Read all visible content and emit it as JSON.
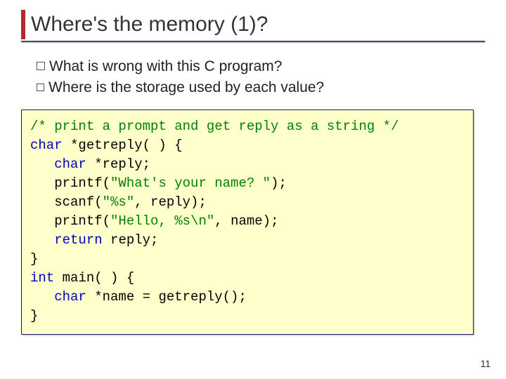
{
  "title": "Where's the memory (1)?",
  "bullets": {
    "b1": "What is wrong with this C program?",
    "b2": "Where is the storage used by each value?"
  },
  "code": {
    "c1": "/* print a prompt and get reply as a string */",
    "l2a": "char",
    "l2b": " *getreply( ) {",
    "l3a": "char",
    "l3b": " *reply;",
    "l4a": "   printf(",
    "l4s": "\"What's your name? \"",
    "l4b": ");",
    "l5a": "   scanf(",
    "l5s": "\"%s\"",
    "l5b": ", reply);",
    "l6a": "   printf(",
    "l6s": "\"Hello, %s\\n\"",
    "l6b": ", name);",
    "l7a": "return",
    "l7b": " reply;",
    "l8": "}",
    "l9a": "int",
    "l9b": " main( ) {",
    "l10a": "char",
    "l10b": " *name = getreply();",
    "l11": "}"
  },
  "page_number": "11"
}
